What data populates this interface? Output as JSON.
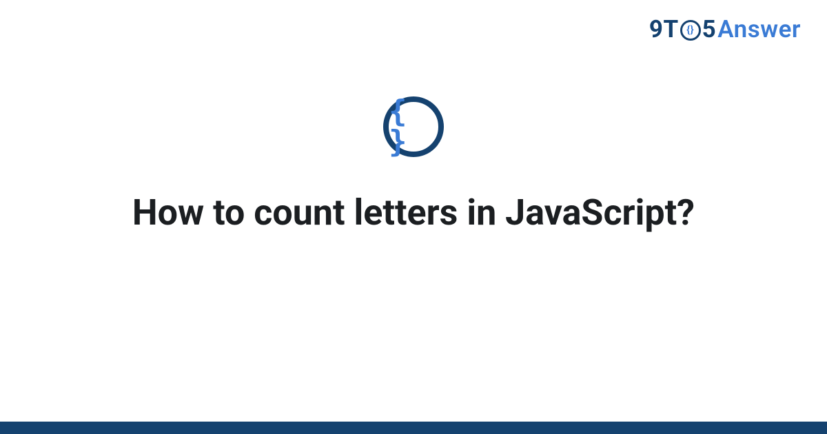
{
  "logo": {
    "nine": "9",
    "t": "T",
    "o_inner": "{}",
    "five": "5",
    "answer": "Answer"
  },
  "badge": {
    "icon_text": "{ }",
    "ring_color": "#15426f",
    "brace_color": "#3a7bd5"
  },
  "title": "How to count letters in JavaScript?",
  "colors": {
    "bar": "#15426f",
    "background": "#ffffff",
    "title": "#1b1e21",
    "logo_dark": "#14416f",
    "logo_light": "#3a7bd5"
  }
}
